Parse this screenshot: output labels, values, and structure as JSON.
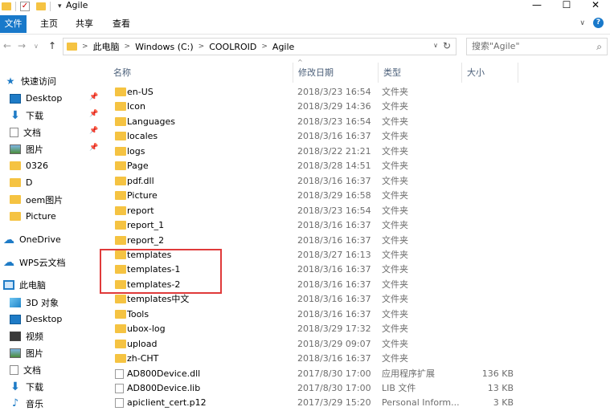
{
  "window": {
    "title": "Agile",
    "controls": [
      "—",
      "☐",
      "✕"
    ]
  },
  "ribbon": {
    "tabs": [
      "文件",
      "主页",
      "共享",
      "查看"
    ]
  },
  "address": {
    "crumbs": [
      "此电脑",
      "Windows (C:)",
      "COOLROID",
      "Agile"
    ],
    "search_placeholder": "搜索\"Agile\""
  },
  "sidebar": {
    "items": [
      {
        "label": "快速访问",
        "icon": "star-icon"
      },
      {
        "label": "Desktop",
        "icon": "desktop-icon",
        "pinned": true
      },
      {
        "label": "下载",
        "icon": "download-icon",
        "pinned": true
      },
      {
        "label": "文档",
        "icon": "document-icon",
        "pinned": true
      },
      {
        "label": "图片",
        "icon": "picture-icon",
        "pinned": true
      },
      {
        "label": "0326",
        "icon": "folder-icon"
      },
      {
        "label": "D",
        "icon": "folder-icon"
      },
      {
        "label": "oem图片",
        "icon": "folder-icon"
      },
      {
        "label": "Picture",
        "icon": "folder-icon"
      },
      {
        "label": "OneDrive",
        "icon": "cloud-icon"
      },
      {
        "label": "WPS云文档",
        "icon": "cloud-icon"
      },
      {
        "label": "此电脑",
        "icon": "computer-icon"
      },
      {
        "label": "3D 对象",
        "icon": "3d-objects-icon"
      },
      {
        "label": "Desktop",
        "icon": "desktop-icon"
      },
      {
        "label": "视频",
        "icon": "video-icon"
      },
      {
        "label": "图片",
        "icon": "picture-icon"
      },
      {
        "label": "文档",
        "icon": "document-icon"
      },
      {
        "label": "下载",
        "icon": "download-icon"
      },
      {
        "label": "音乐",
        "icon": "music-icon"
      }
    ]
  },
  "columns": {
    "name": "名称",
    "date": "修改日期",
    "type": "类型",
    "size": "大小"
  },
  "files": [
    {
      "name": "en-US",
      "date": "2018/3/23 16:54",
      "type": "文件夹",
      "size": "",
      "kind": "folder"
    },
    {
      "name": "Icon",
      "date": "2018/3/29 14:36",
      "type": "文件夹",
      "size": "",
      "kind": "folder"
    },
    {
      "name": "Languages",
      "date": "2018/3/23 16:54",
      "type": "文件夹",
      "size": "",
      "kind": "folder"
    },
    {
      "name": "locales",
      "date": "2018/3/16 16:37",
      "type": "文件夹",
      "size": "",
      "kind": "folder"
    },
    {
      "name": "logs",
      "date": "2018/3/22 21:21",
      "type": "文件夹",
      "size": "",
      "kind": "folder"
    },
    {
      "name": "Page",
      "date": "2018/3/28 14:51",
      "type": "文件夹",
      "size": "",
      "kind": "folder"
    },
    {
      "name": "pdf.dll",
      "date": "2018/3/16 16:37",
      "type": "文件夹",
      "size": "",
      "kind": "folder"
    },
    {
      "name": "Picture",
      "date": "2018/3/29 16:58",
      "type": "文件夹",
      "size": "",
      "kind": "folder"
    },
    {
      "name": "report",
      "date": "2018/3/23 16:54",
      "type": "文件夹",
      "size": "",
      "kind": "folder"
    },
    {
      "name": "report_1",
      "date": "2018/3/16 16:37",
      "type": "文件夹",
      "size": "",
      "kind": "folder"
    },
    {
      "name": "report_2",
      "date": "2018/3/16 16:37",
      "type": "文件夹",
      "size": "",
      "kind": "folder"
    },
    {
      "name": "templates",
      "date": "2018/3/27 16:13",
      "type": "文件夹",
      "size": "",
      "kind": "folder"
    },
    {
      "name": "templates-1",
      "date": "2018/3/16 16:37",
      "type": "文件夹",
      "size": "",
      "kind": "folder"
    },
    {
      "name": "templates-2",
      "date": "2018/3/16 16:37",
      "type": "文件夹",
      "size": "",
      "kind": "folder"
    },
    {
      "name": "templates中文",
      "date": "2018/3/16 16:37",
      "type": "文件夹",
      "size": "",
      "kind": "folder"
    },
    {
      "name": "Tools",
      "date": "2018/3/16 16:37",
      "type": "文件夹",
      "size": "",
      "kind": "folder"
    },
    {
      "name": "ubox-log",
      "date": "2018/3/29 17:32",
      "type": "文件夹",
      "size": "",
      "kind": "folder"
    },
    {
      "name": "upload",
      "date": "2018/3/29 09:07",
      "type": "文件夹",
      "size": "",
      "kind": "folder"
    },
    {
      "name": "zh-CHT",
      "date": "2018/3/16 16:37",
      "type": "文件夹",
      "size": "",
      "kind": "folder"
    },
    {
      "name": "AD800Device.dll",
      "date": "2017/8/30 17:00",
      "type": "应用程序扩展",
      "size": "136 KB",
      "kind": "file"
    },
    {
      "name": "AD800Device.lib",
      "date": "2017/8/30 17:00",
      "type": "LIB 文件",
      "size": "13 KB",
      "kind": "file"
    },
    {
      "name": "apiclient_cert.p12",
      "date": "2017/3/29 15:20",
      "type": "Personal Inform...",
      "size": "3 KB",
      "kind": "file"
    }
  ]
}
